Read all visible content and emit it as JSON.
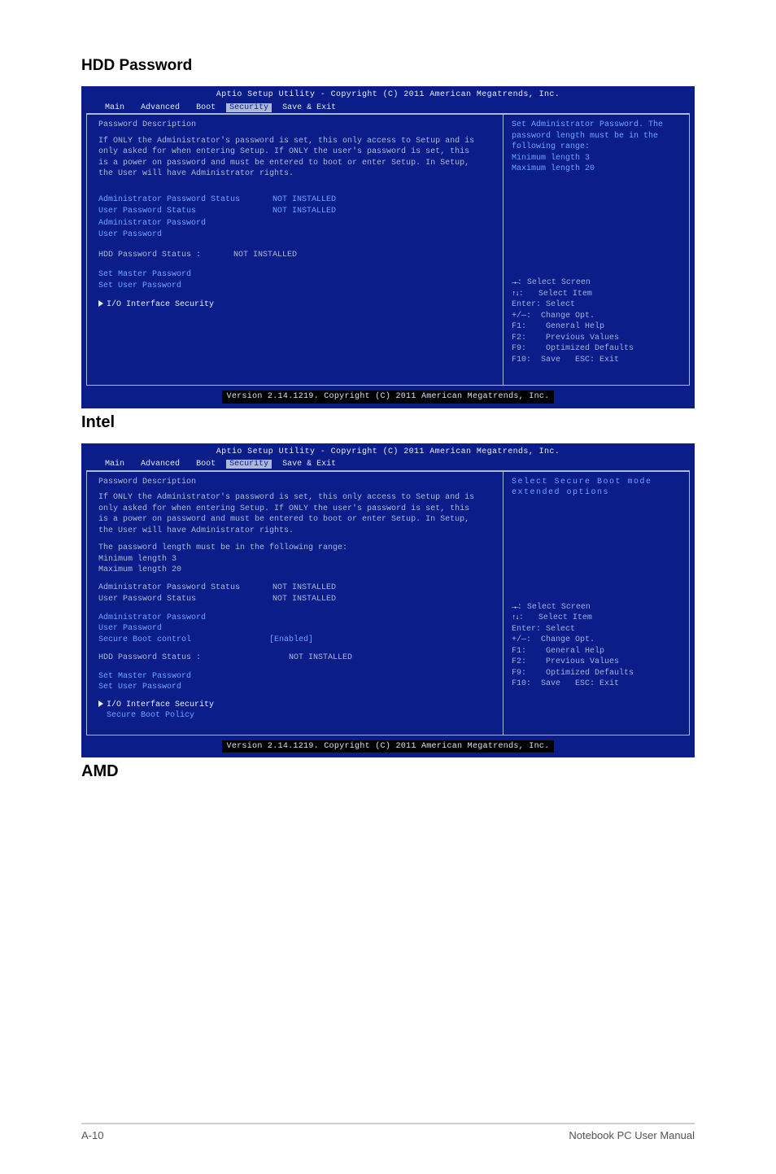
{
  "page": {
    "section1_title": "HDD Password",
    "section2_title": "Intel",
    "section3_title": "AMD",
    "footer_left": "A-10",
    "footer_right": "Notebook PC User Manual"
  },
  "bios_header": "Aptio Setup Utility - Copyright (C) 2011 American Megatrends, Inc.",
  "bios_footer": "Version 2.14.1219. Copyright (C) 2011 American Megatrends, Inc.",
  "tabs": {
    "main": "Main",
    "advanced": "Advanced",
    "boot": "Boot",
    "security": "Security",
    "save": "Save & Exit"
  },
  "pwdesc_label": "Password Description",
  "pwdesc_body": "If ONLY the Administrator's password is set, this only access to Setup and is only asked for when entering Setup. If ONLY the user's password is set, this is a power on password and must be entered to boot or enter Setup. In Setup, the User will have Administrator rights.",
  "help_keys": {
    "select_screen": "Select Screen",
    "select_item": "Select Item",
    "enter": "Enter: Select",
    "change": "+/—:  Change Opt.",
    "f1": "F1:    General Help",
    "f2": "F2:    Previous Values",
    "f9": "F9:    Optimized Defaults",
    "f10": "F10:  Save   ESC: Exit"
  },
  "screen1": {
    "admin_status_lbl": "Administrator Password Status",
    "user_status_lbl": "User Password Status",
    "admin_pw_lbl": "Administrator Password",
    "user_pw_lbl": "User Password",
    "hdd_status_lbl": "HDD Password Status :",
    "set_master_lbl": "Set Master Password",
    "set_user_lbl": "Set User Password",
    "io_sec_lbl": "I/O Interface Security",
    "not_installed": "NOT INSTALLED",
    "help": "Set Administrator Password. The password length must be in the following range:",
    "help_min": "Minimum length  3",
    "help_max": "Maximum length 20"
  },
  "screen2": {
    "pwlen_intro": "The password length must be in the following range:",
    "min": "Minimum length   3",
    "max": "Maximum length  20",
    "admin_status_lbl": "Administrator Password Status",
    "user_status_lbl": "User Password Status",
    "admin_pw_lbl": "Administrator Password",
    "user_pw_lbl": "User Password",
    "secure_boot_ctrl_lbl": "Secure Boot control",
    "secure_boot_ctrl_val": "[Enabled]",
    "hdd_status_lbl": "HDD Password Status :",
    "set_master_lbl": "Set Master Password",
    "set_user_lbl": "Set User Password",
    "io_sec_lbl": "I/O Interface Security",
    "secure_boot_policy_lbl": "Secure Boot Policy",
    "not_installed": "NOT INSTALLED",
    "help": "Select Secure Boot mode extended options"
  }
}
